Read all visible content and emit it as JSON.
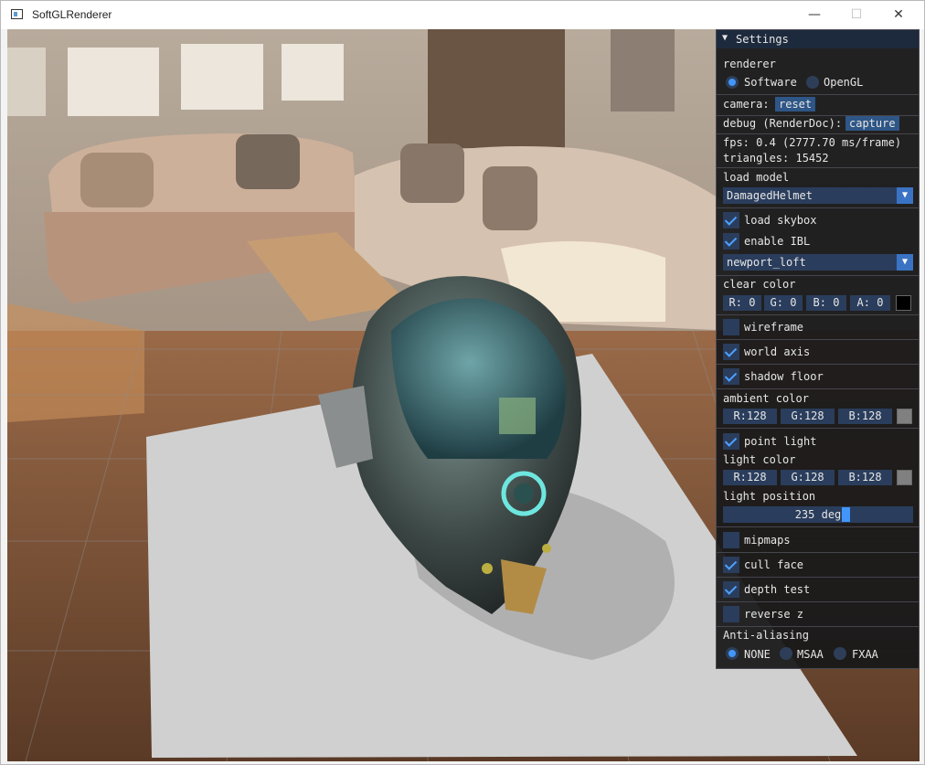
{
  "window": {
    "title": "SoftGLRenderer",
    "minimize": "—",
    "maximize": "☐",
    "close": "✕"
  },
  "panel": {
    "title": "Settings",
    "collapse_glyph": "▼",
    "renderer": {
      "label": "renderer",
      "options": [
        "Software",
        "OpenGL"
      ],
      "selected": "Software"
    },
    "camera": {
      "label": "camera:",
      "button": "reset"
    },
    "debug": {
      "label": "debug (RenderDoc):",
      "button": "capture"
    },
    "fps": "fps: 0.4 (2777.70 ms/frame)",
    "triangles": "triangles: 15452",
    "load_model": {
      "label": "load model",
      "value": "DamagedHelmet"
    },
    "load_skybox": {
      "label": "load skybox",
      "checked": true
    },
    "enable_ibl": {
      "label": "enable IBL",
      "checked": true
    },
    "skybox": {
      "value": "newport_loft"
    },
    "clear_color": {
      "label": "clear color",
      "r": "R:  0",
      "g": "G:  0",
      "b": "B:  0",
      "a": "A:  0",
      "swatch": "#000000"
    },
    "wireframe": {
      "label": "wireframe",
      "checked": false
    },
    "world_axis": {
      "label": "world axis",
      "checked": true
    },
    "shadow_floor": {
      "label": "shadow floor",
      "checked": true
    },
    "ambient_color": {
      "label": "ambient color",
      "r": "R:128",
      "g": "G:128",
      "b": "B:128",
      "swatch": "#808080"
    },
    "point_light": {
      "label": "point light",
      "checked": true
    },
    "light_color": {
      "label": "light color",
      "r": "R:128",
      "g": "G:128",
      "b": "B:128",
      "swatch": "#808080"
    },
    "light_position": {
      "label": "light position",
      "value": "235 deg",
      "fraction": 0.65
    },
    "mipmaps": {
      "label": "mipmaps",
      "checked": false
    },
    "cull_face": {
      "label": "cull face",
      "checked": true
    },
    "depth_test": {
      "label": "depth test",
      "checked": true
    },
    "reverse_z": {
      "label": "reverse z",
      "checked": false
    },
    "anti_aliasing": {
      "label": "Anti-aliasing",
      "options": [
        "NONE",
        "MSAA",
        "FXAA"
      ],
      "selected": "NONE"
    }
  },
  "colors": {
    "accent": "#4296fa",
    "frame_bg": "#2a3d5c",
    "button": "#2e5686",
    "panel_bg": "#18181a"
  }
}
